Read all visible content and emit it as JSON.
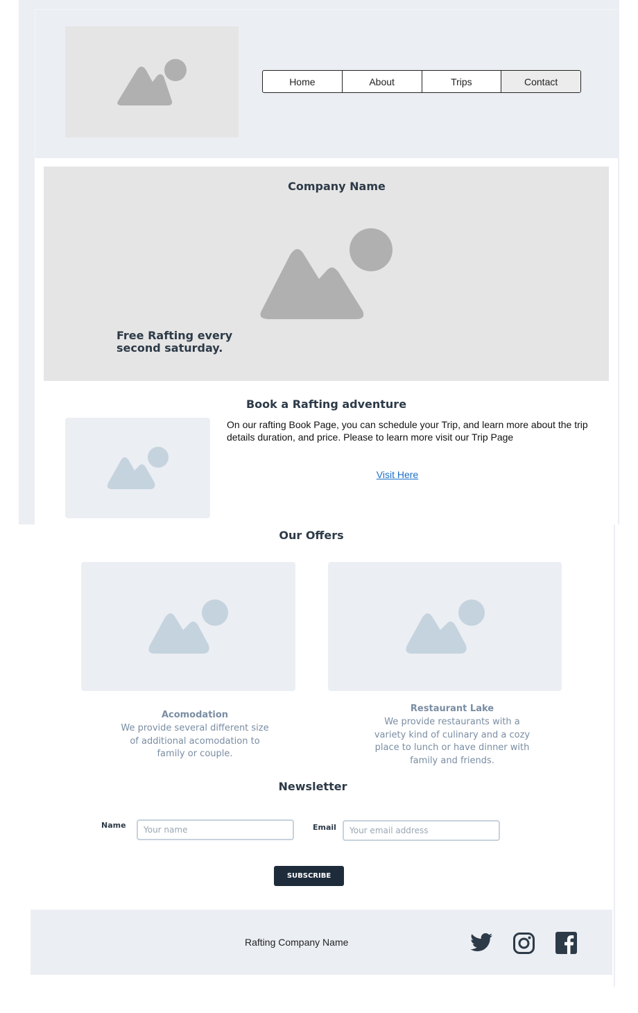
{
  "nav": {
    "items": [
      {
        "label": "Home"
      },
      {
        "label": "About"
      },
      {
        "label": "Trips"
      },
      {
        "label": "Contact"
      }
    ]
  },
  "hero": {
    "title": "Company Name",
    "tagline": "Free Rafting every second saturday."
  },
  "booking": {
    "title": "Book a Rafting adventure",
    "text": "On our rafting Book Page, you can schedule your Trip, and learn more about the trip details duration, and price. Please to learn more visit our Trip Page",
    "link_label": "Visit Here"
  },
  "offers": {
    "title": "Our Offers",
    "cards": [
      {
        "title": "Acomodation",
        "text": "We provide several different size of additional acomodation to family or couple."
      },
      {
        "title": "Restaurant Lake",
        "text": "We provide restaurants with a variety kind of culinary and a cozy place to lunch or have dinner with family and friends."
      }
    ]
  },
  "newsletter": {
    "title": "Newsletter",
    "name_label": "Name",
    "name_placeholder": "Your name",
    "email_label": "Email",
    "email_placeholder": "Your email address",
    "subscribe_label": "SUBSCRIBE"
  },
  "footer": {
    "company_name": "Rafting Company Name",
    "social_icons": [
      "twitter-icon",
      "instagram-icon",
      "facebook-icon"
    ]
  },
  "colors": {
    "panel_bg": "#ebeef3",
    "heading": "#2d3a48",
    "muted_text": "#7a8da3",
    "link": "#1a6fc9",
    "button_bg": "#1d2b3a",
    "placeholder_gray": "#e5e5e5",
    "placeholder_icon_gray": "#b0b0b0",
    "placeholder_blue_bg": "#ebeef3",
    "placeholder_blue_icon": "#c5d3de"
  }
}
